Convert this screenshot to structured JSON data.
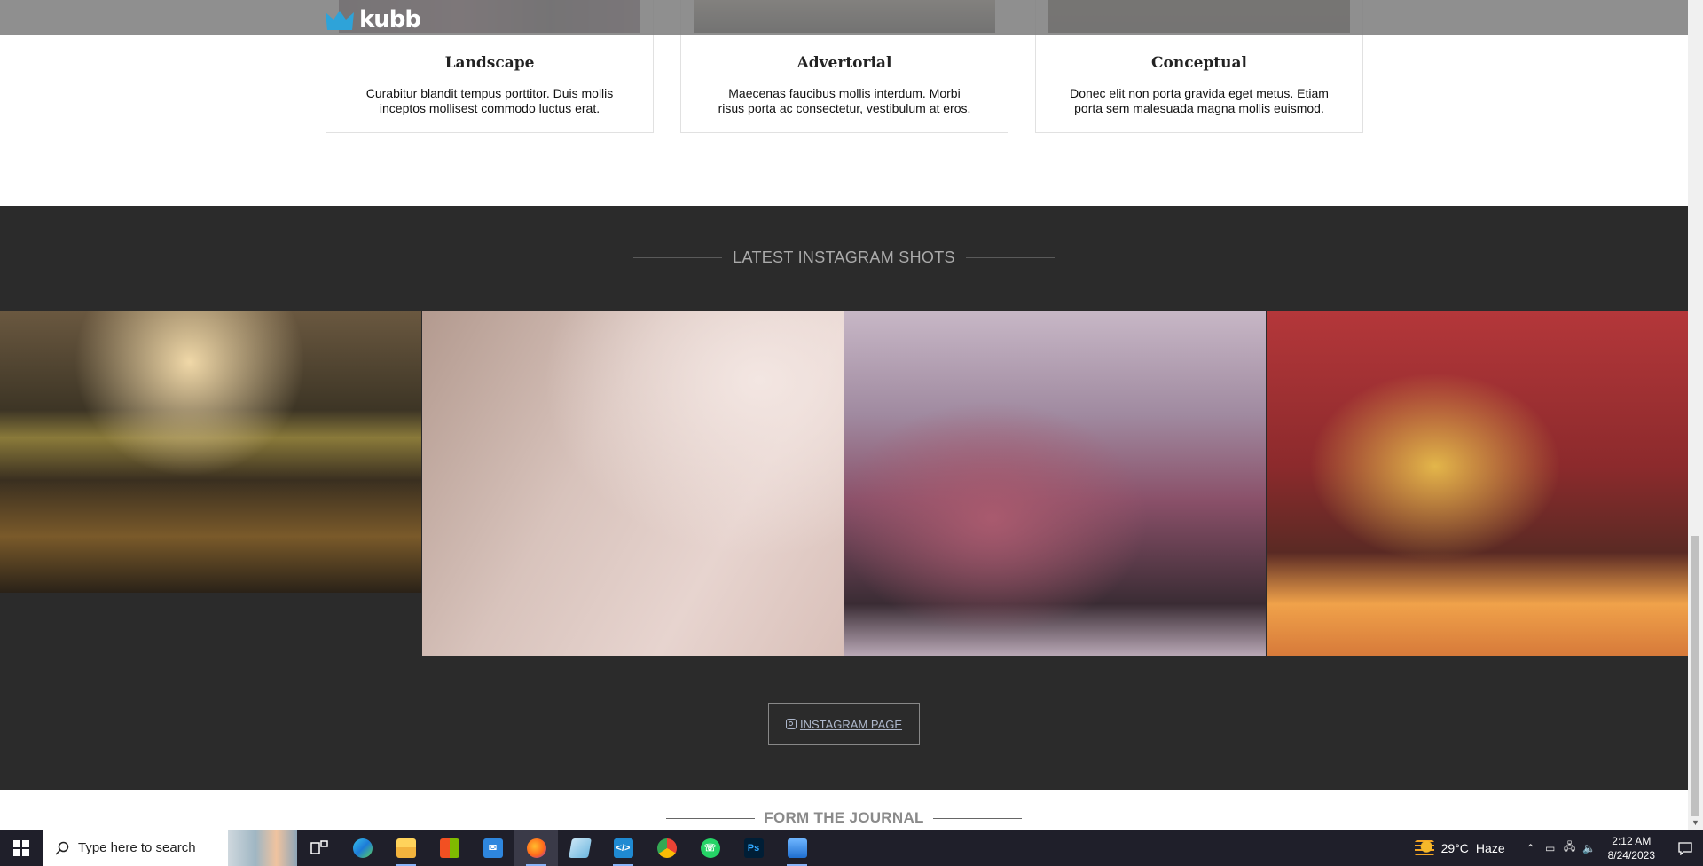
{
  "header": {
    "logo_text": "kubb"
  },
  "cards": [
    {
      "title": "Landscape",
      "desc": "Curabitur blandit tempus porttitor. Duis mollis inceptos mollisest commodo luctus erat."
    },
    {
      "title": "Advertorial",
      "desc": "Maecenas faucibus mollis interdum. Morbi risus porta ac consectetur, vestibulum at eros."
    },
    {
      "title": "Conceptual",
      "desc": "Donec elit non porta gravida eget metus. Etiam porta sem malesuada magna mollis euismod."
    }
  ],
  "instagram": {
    "heading": "LATEST INSTAGRAM SHOTS",
    "photos": [
      "autumn-leaves-photo",
      "clothespins-photo",
      "rusty-truck-photo",
      "red-machinery-wires-photo"
    ],
    "button_label": "INSTAGRAM PAGE"
  },
  "journal": {
    "heading": "FORM THE JOURNAL"
  },
  "taskbar": {
    "search_placeholder": "Type here to search",
    "apps": [
      "task-view",
      "edge",
      "file-explorer",
      "microsoft-store",
      "mail",
      "firefox",
      "notepad",
      "vscode",
      "chrome",
      "whatsapp",
      "photoshop",
      "photos"
    ],
    "weather": {
      "temp": "29°C",
      "condition": "Haze"
    },
    "time": "2:12 AM",
    "date": "8/24/2023"
  },
  "colors": {
    "accent": "#2ea3d9",
    "section_bg": "#2b2b2b",
    "taskbar_bg": "#1f1f2a"
  }
}
